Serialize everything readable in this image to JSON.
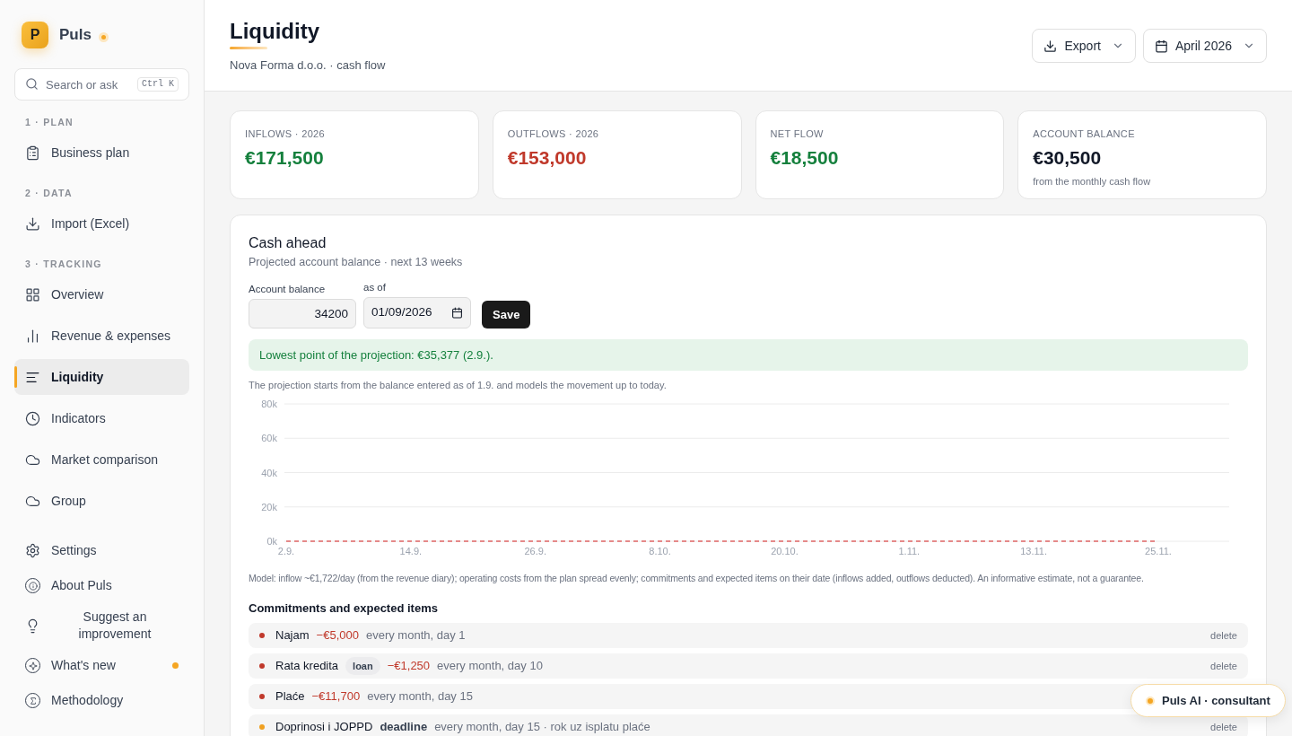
{
  "brand": {
    "initial": "P",
    "name": "Puls",
    "live": true
  },
  "search": {
    "placeholder": "Search or ask",
    "shortcut": "Ctrl K"
  },
  "sidebar": {
    "sections": [
      {
        "heading": "1 · PLAN",
        "items": [
          {
            "label": "Business plan",
            "selected": false
          }
        ]
      },
      {
        "heading": "2 · DATA",
        "items": [
          {
            "label": "Import (Excel)",
            "selected": false
          }
        ]
      },
      {
        "heading": "3 · TRACKING",
        "items": [
          {
            "label": "Overview",
            "selected": false
          },
          {
            "label": "Revenue & expenses",
            "selected": false
          },
          {
            "label": "Liquidity",
            "selected": true
          },
          {
            "label": "Indicators",
            "selected": false
          },
          {
            "label": "Market comparison",
            "selected": false
          },
          {
            "label": "Group",
            "selected": false
          }
        ]
      }
    ],
    "footer_items": [
      {
        "label": "Settings",
        "kind": "plain",
        "has_update": false
      },
      {
        "label": "About Puls",
        "kind": "plain",
        "has_update": false
      },
      {
        "label": "Suggest an improvement",
        "kind": "centered",
        "has_update": false
      },
      {
        "label": "What's new",
        "kind": "plain",
        "has_update": true
      },
      {
        "label": "Methodology",
        "kind": "plain",
        "has_update": false
      }
    ]
  },
  "header": {
    "title": "Liquidity",
    "subtitle": "Nova Forma d.o.o. · cash flow",
    "export_button": "Export",
    "period_button": "April 2026"
  },
  "kpis": [
    {
      "label": "INFLOWS · 2026",
      "value": "€171,500",
      "color": "#15803d"
    },
    {
      "label": "OUTFLOWS · 2026",
      "value": "€153,000",
      "color": "#c0392b"
    },
    {
      "label": "NET FLOW",
      "value": "€18,500",
      "color": "#15803d"
    },
    {
      "label": "ACCOUNT BALANCE",
      "value": "€30,500",
      "color": "#111827",
      "note": "from the monthly cash flow"
    }
  ],
  "cash_ahead": {
    "title": "Cash ahead",
    "subtitle": "Projected account balance · next 13 weeks",
    "balance_field": {
      "label": "Account balance",
      "value": "34200"
    },
    "date_field": {
      "label": "as of",
      "value": "01/09/2026"
    },
    "save_button": "Save",
    "alert": "Lowest point of the projection: €35,377 (2.9.).",
    "note": "The projection starts from the balance entered as of 1.9. and models the movement up to today.",
    "chart_data": {
      "type": "line",
      "grid": true,
      "series": [
        {
          "color": "#e06666",
          "line_style": "dashed",
          "values": [
            0,
            0,
            0,
            0,
            0,
            0,
            0,
            0
          ]
        }
      ],
      "ylim": [
        0,
        80000
      ],
      "yticks": [
        {
          "value": 0,
          "label": "0k"
        },
        {
          "value": 20000,
          "label": "20k"
        },
        {
          "value": 40000,
          "label": "40k"
        },
        {
          "value": 60000,
          "label": "60k"
        },
        {
          "value": 80000,
          "label": "80k"
        }
      ],
      "categories": [
        "2.9.",
        "14.9.",
        "26.9.",
        "8.10.",
        "20.10.",
        "1.11.",
        "13.11.",
        "25.11."
      ]
    },
    "model_note": "Model: inflow ~€1,722/day (from the revenue diary); operating costs from the plan spread evenly; commitments and expected items on their date (inflows added, outflows deducted). An informative estimate, not a guarantee.",
    "commitments_title": "Commitments and expected items",
    "commitments": [
      {
        "name": "Najam",
        "amount": "−€5,000",
        "schedule": "every month, day 1",
        "color": "#c0392b",
        "action": "delete"
      },
      {
        "name": "Rata kredita",
        "tag": "loan",
        "tag_pill": true,
        "amount": "−€1,250",
        "schedule": "every month, day 10",
        "color": "#c0392b",
        "action": "delete"
      },
      {
        "name": "Plaće",
        "amount": "−€11,700",
        "schedule": "every month, day 15",
        "color": "#c0392b"
      },
      {
        "name": "Doprinosi i JOPPD",
        "tag": "deadline",
        "tag_pill": false,
        "schedule": "every month, day 15 · rok uz isplatu plaće",
        "color": "#f0a020",
        "action": "delete"
      }
    ]
  },
  "assistant_button": "Puls AI · consultant"
}
